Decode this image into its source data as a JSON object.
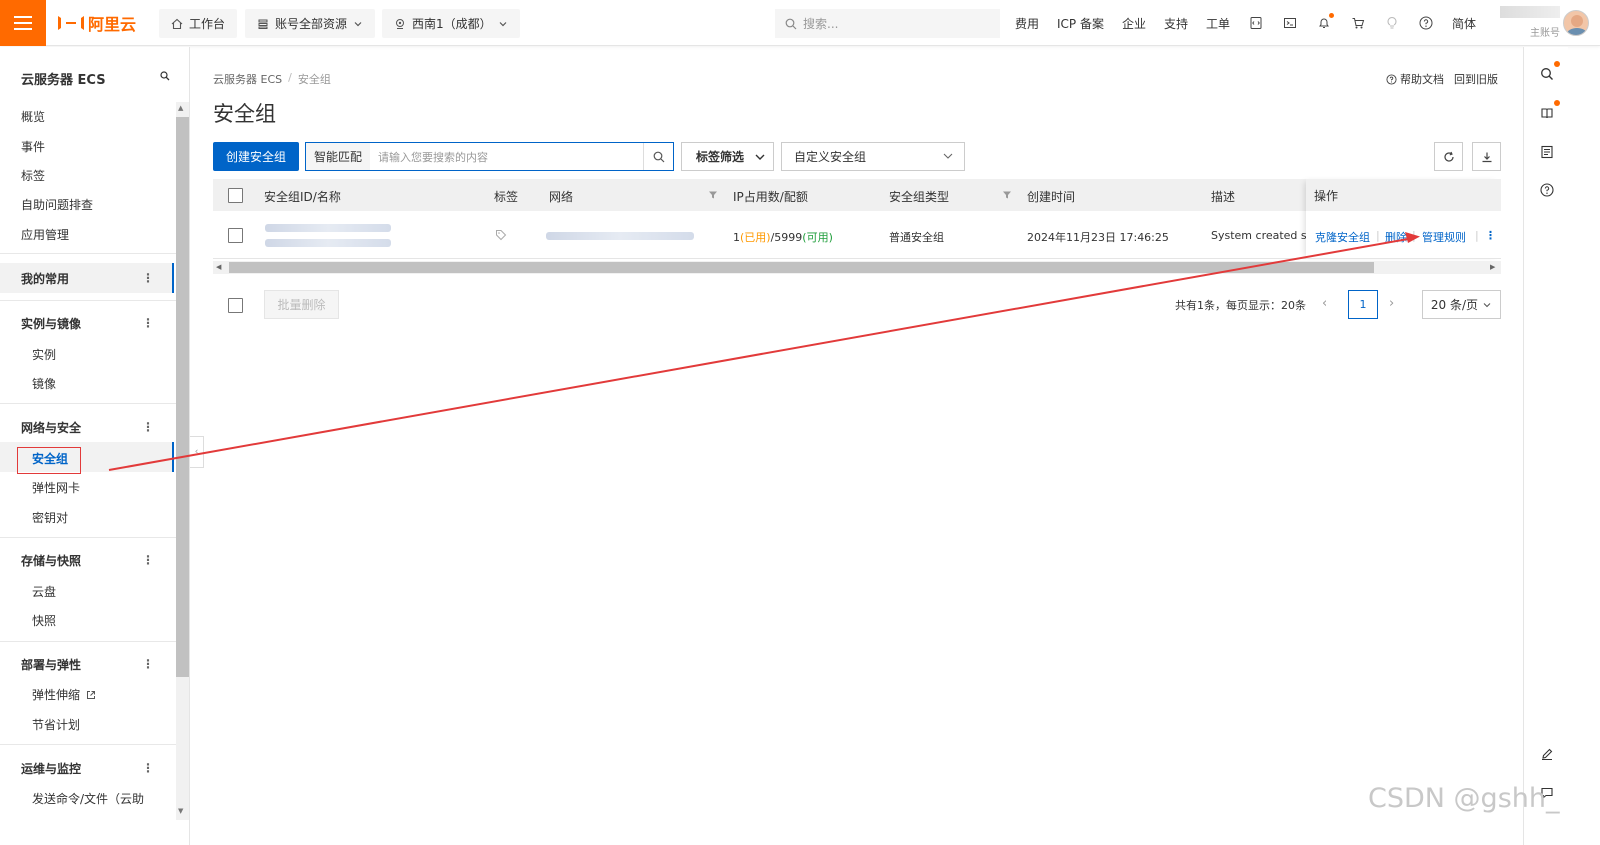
{
  "topbar": {
    "logo_text": "阿里云",
    "workbench": "工作台",
    "account_scope": "账号全部资源",
    "region": "西南1（成都）",
    "search_placeholder": "搜索...",
    "links": [
      "费用",
      "ICP 备案",
      "企业",
      "支持",
      "工单"
    ],
    "lang": "简体",
    "account_role": "主账号"
  },
  "sidebar": {
    "title": "云服务器 ECS",
    "top_items": [
      "概览",
      "事件",
      "标签",
      "自助问题排查",
      "应用管理"
    ],
    "favorites": "我的常用",
    "groups": [
      {
        "label": "实例与镜像",
        "items": [
          "实例",
          "镜像"
        ]
      },
      {
        "label": "网络与安全",
        "items": [
          "安全组",
          "弹性网卡",
          "密钥对"
        ]
      },
      {
        "label": "存储与快照",
        "items": [
          "云盘",
          "快照"
        ]
      },
      {
        "label": "部署与弹性",
        "items": [
          "弹性伸缩",
          "节省计划"
        ]
      },
      {
        "label": "运维与监控",
        "items": [
          "发送命令/文件（云助"
        ]
      }
    ]
  },
  "main": {
    "breadcrumb": [
      "云服务器 ECS",
      "安全组"
    ],
    "help_doc": "帮助文档",
    "back_old": "回到旧版",
    "title": "安全组",
    "create_btn": "创建安全组",
    "search_mode": "智能匹配",
    "search_placeholder": "请输入您要搜索的内容",
    "tag_filter": "标签筛选",
    "custom_select": "自定义安全组",
    "columns": [
      "安全组ID/名称",
      "标签",
      "网络",
      "IP占用数/配额",
      "安全组类型",
      "创建时间",
      "描述",
      "操作"
    ],
    "row": {
      "ip_used": "1",
      "ip_used_label": "(已用)",
      "ip_quota": "/5999",
      "ip_avail_label": "(可用)",
      "type": "普通安全组",
      "created": "2024年11月23日 17:46:25",
      "desc": "System created secu",
      "ops": [
        "克隆安全组",
        "删除",
        "管理规则"
      ]
    },
    "batch_delete": "批量删除",
    "pager_info": "共有1条，每页显示：20条",
    "page": "1",
    "page_size": "20 条/页"
  },
  "colors": {
    "brand": "#ff6a00",
    "primary": "#0064c8",
    "annotation": "#e23a3a",
    "used": "#ff9900",
    "available": "#1f9e3b"
  },
  "watermark": "CSDN @gshh_"
}
